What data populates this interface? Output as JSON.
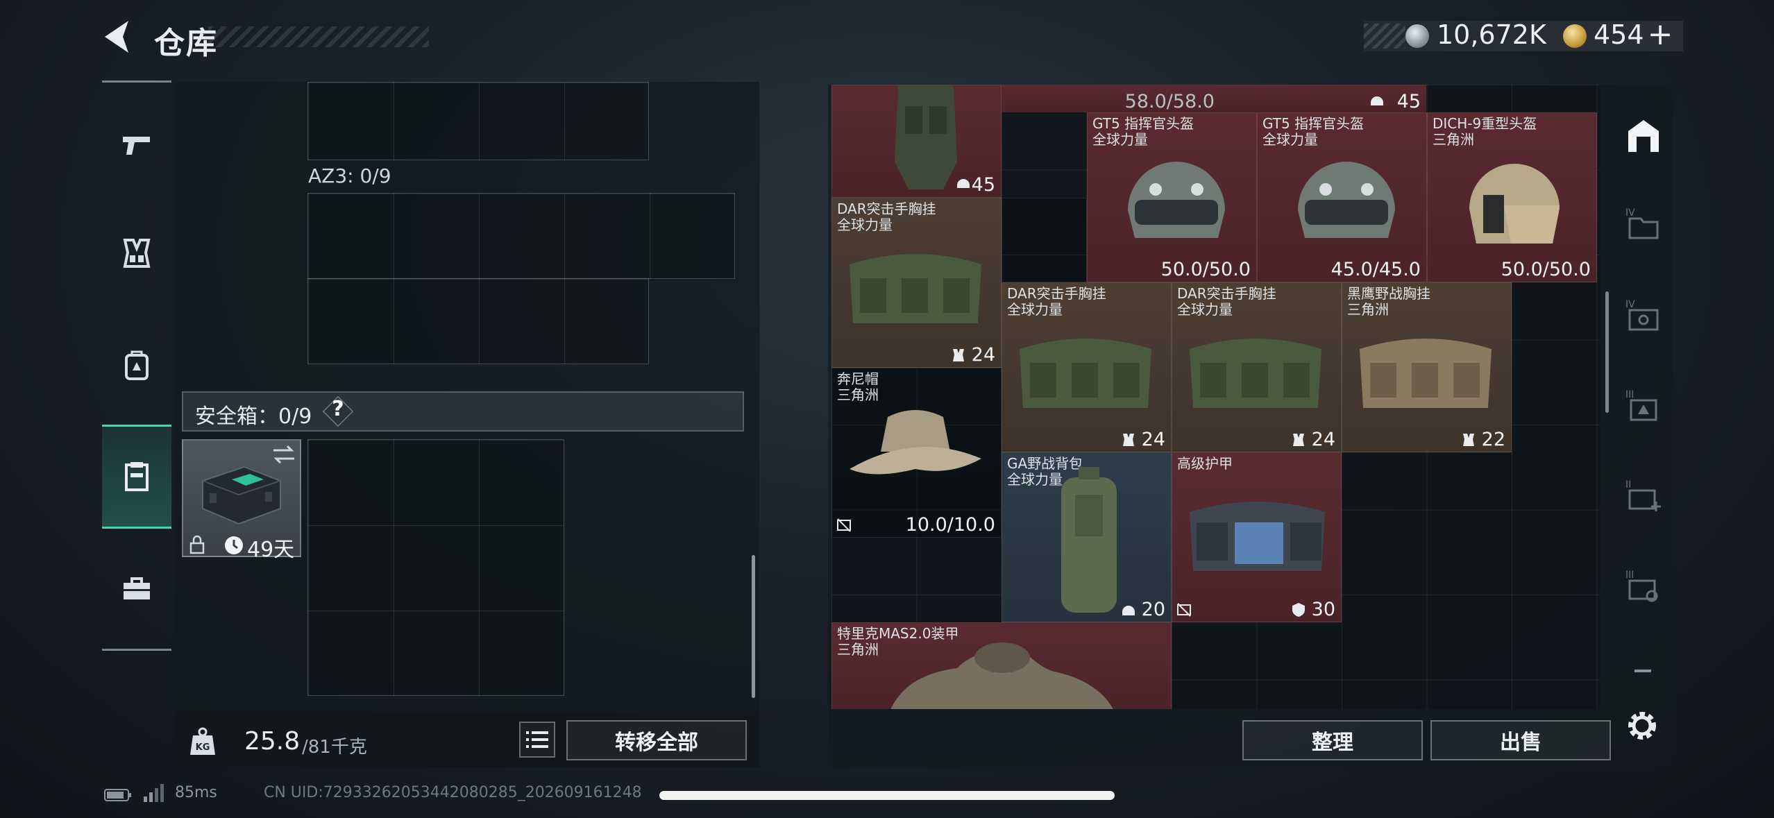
{
  "header": {
    "title": "仓库",
    "silver_amount": "10,672K",
    "gold_amount": "454",
    "plus_label": "+"
  },
  "left_rail": {
    "items": [
      {
        "icon": "pistol-icon"
      },
      {
        "icon": "chest-rig-icon"
      },
      {
        "icon": "backpack-icon"
      },
      {
        "icon": "safe-box-icon",
        "active": true
      },
      {
        "icon": "toolbox-icon"
      }
    ]
  },
  "left_panel": {
    "az3_label": "AZ3: 0/9",
    "safe_box_label": "安全箱：0/9",
    "help_label": "?",
    "safe_item_time": "49天"
  },
  "weight": {
    "current": "25.8",
    "max": "/81千克",
    "unit_icon": "KG"
  },
  "buttons": {
    "transfer_all": "转移全部",
    "sort": "整理",
    "sell": "出售"
  },
  "items": {
    "top_vest_val": "45",
    "top_partial_val": "58.0/58.0",
    "top_right_val": "45",
    "helmet1": {
      "name": "GT5 指挥官头盔",
      "sub": "全球力量",
      "val": "50.0/50.0"
    },
    "helmet2": {
      "name": "GT5 指挥官头盔",
      "sub": "全球力量",
      "val": "45.0/45.0"
    },
    "helmet3": {
      "name": "DICH-9重型头盔",
      "sub": "三角洲",
      "val": "50.0/50.0"
    },
    "rig1": {
      "name": "DAR突击手胸挂",
      "sub": "全球力量",
      "val": "24"
    },
    "rig2": {
      "name": "DAR突击手胸挂",
      "sub": "全球力量",
      "val": "24"
    },
    "rig3": {
      "name": "DAR突击手胸挂",
      "sub": "全球力量",
      "val": "24"
    },
    "rig4": {
      "name": "黑鹰野战胸挂",
      "sub": "三角洲",
      "val": "22"
    },
    "hat": {
      "name": "奔尼帽",
      "sub": "三角洲",
      "val": "10.0/10.0"
    },
    "backpack": {
      "name": "GA野战背包",
      "sub": "全球力量",
      "val": "20"
    },
    "armor": {
      "name": "高级护甲",
      "val": "30"
    },
    "armor2": {
      "name": "特里克MAS2.0装甲",
      "sub": "三角洲"
    }
  },
  "status": {
    "ping": "85ms",
    "uid": "CN UID:729332620534420802​85_202609161248"
  },
  "colors": {
    "accent": "#45d6ac",
    "item_red": "#5a2a31",
    "item_brown": "#4d3e33",
    "item_blue": "#2e3d4b"
  }
}
